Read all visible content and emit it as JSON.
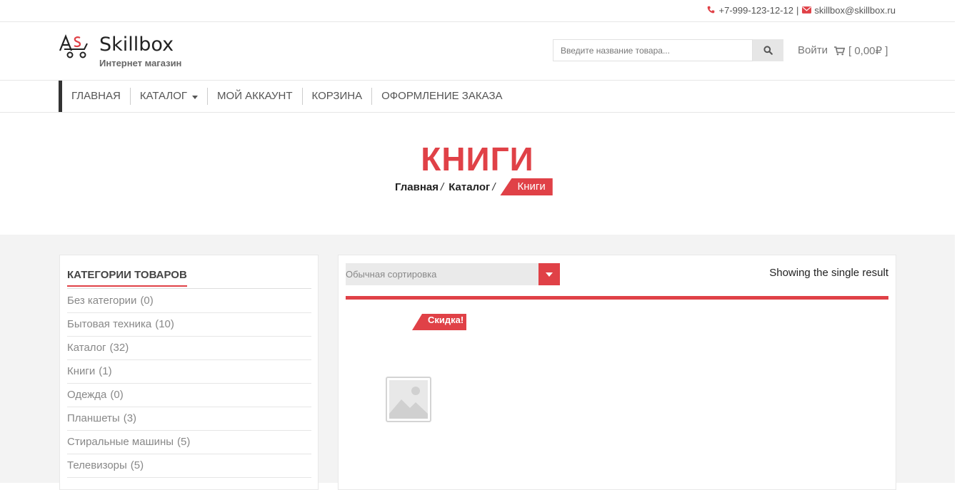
{
  "topbar": {
    "phone": "+7-999-123-12-12",
    "separator": "|",
    "email": "skillbox@skillbox.ru",
    "phone_icon": "phone-icon",
    "email_icon": "envelope-icon"
  },
  "header": {
    "logo_name": "Skillbox",
    "logo_sub": "Интернет магазин",
    "search_placeholder": "Введите название товара...",
    "search_icon": "search-icon",
    "login_label": "Войти",
    "cart_label": "[ 0,00₽ ]",
    "cart_icon": "cart-icon"
  },
  "nav": {
    "items": [
      {
        "label": "ГЛАВНАЯ"
      },
      {
        "label": "КАТАЛОГ",
        "has_dropdown": true
      },
      {
        "label": "МОЙ АККАУНТ"
      },
      {
        "label": "КОРЗИНА"
      },
      {
        "label": "ОФОРМЛЕНИЕ ЗАКАЗА"
      }
    ]
  },
  "hero": {
    "title": "КНИГИ",
    "breadcrumbs": [
      {
        "label": "Главная",
        "sep": "/"
      },
      {
        "label": "Каталог",
        "sep": "/"
      }
    ],
    "current": "Книги"
  },
  "sidebar": {
    "title": "КАТЕГОРИИ ТОВАРОВ",
    "categories": [
      {
        "name": "Без категории",
        "count": "(0)"
      },
      {
        "name": "Бытовая техника",
        "count": "(10)"
      },
      {
        "name": "Каталог",
        "count": "(32)"
      },
      {
        "name": "Книги",
        "count": "(1)"
      },
      {
        "name": "Одежда",
        "count": "(0)"
      },
      {
        "name": "Планшеты",
        "count": "(3)"
      },
      {
        "name": "Стиральные машины",
        "count": "(5)"
      },
      {
        "name": "Телевизоры",
        "count": "(5)"
      }
    ]
  },
  "content": {
    "sort_value": "Обычная сортировка",
    "result_count": "Showing the single result",
    "sale_badge": "Скидка!",
    "product_image_icon": "image-placeholder-icon"
  },
  "colors": {
    "accent": "#e04147",
    "text": "#555555",
    "background_main": "#f3f3f3"
  }
}
